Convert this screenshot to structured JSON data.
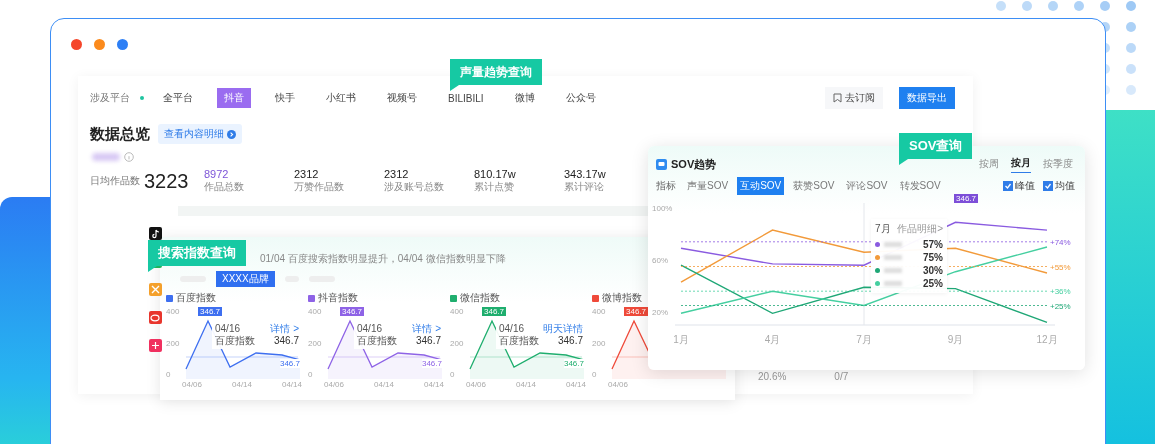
{
  "overview": {
    "platform_filter": {
      "label": "涉及平台",
      "options": [
        {
          "label": "全平台",
          "selected": false
        },
        {
          "label": "抖音",
          "selected": true
        },
        {
          "label": "快手",
          "selected": false
        },
        {
          "label": "小红书",
          "selected": false
        },
        {
          "label": "视频号",
          "selected": false
        },
        {
          "label": "BILIBILI",
          "selected": false
        },
        {
          "label": "微博",
          "selected": false
        },
        {
          "label": "公众号",
          "selected": false
        }
      ]
    },
    "subscribe": "去订阅",
    "export": "数据导出",
    "title": "数据总览",
    "detail_link": "查看内容明细",
    "daily": {
      "label": "日均作品数",
      "value": "3223"
    },
    "stats": [
      {
        "value": "8972",
        "label": "作品总数",
        "highlight": true
      },
      {
        "value": "2312",
        "label": "万赞作品数",
        "highlight": false
      },
      {
        "value": "2312",
        "label": "涉及账号总数",
        "highlight": false
      },
      {
        "value": "810.17w",
        "label": "累计点赞",
        "highlight": false
      },
      {
        "value": "343.17w",
        "label": "累计评论",
        "highlight": false
      }
    ],
    "bottom_row": [
      "20.6%",
      "0/7"
    ]
  },
  "volume_callout": "声量趋势查询",
  "search_panel": {
    "callout": "搜索指数查询",
    "summary": "01/04 百度搜索指数明显提升，04/04 微信指数明显下降",
    "brand_tab": "XXXX品牌",
    "charts": [
      {
        "title": "百度指数",
        "color": "#3e6ff0",
        "peak": "346.7",
        "end": "346.7",
        "y_labels": [
          "400",
          "200",
          "0"
        ],
        "x_labels": [
          "04/06",
          "04/14",
          "04/14"
        ],
        "tooltip": {
          "date": "04/16",
          "link": "详情 >",
          "series": "百度指数",
          "value": "346.7"
        }
      },
      {
        "title": "抖音指数",
        "color": "#8e63e6",
        "peak": "346.7",
        "end": "346.7",
        "y_labels": [
          "400",
          "200",
          "0"
        ],
        "x_labels": [
          "04/06",
          "04/14",
          "04/14"
        ],
        "tooltip": {
          "date": "04/16",
          "link": "详情 >",
          "series": "百度指数",
          "value": "346.7"
        }
      },
      {
        "title": "微信指数",
        "color": "#1fae6e",
        "peak": "346.7",
        "end": "346.7",
        "y_labels": [
          "400",
          "200",
          "0"
        ],
        "x_labels": [
          "04/06",
          "04/14",
          "04/14"
        ],
        "tooltip": {
          "date": "04/16",
          "link": "明天详情",
          "series": "百度指数",
          "value": "346.7"
        }
      },
      {
        "title": "微博指数",
        "color": "#ef4a3a",
        "peak": "346.7",
        "y_labels": [
          "400",
          "200",
          "0"
        ],
        "x_labels": [
          "04/06"
        ]
      }
    ]
  },
  "sov_panel": {
    "callout": "SOV查询",
    "title": "SOV趋势",
    "periods": [
      {
        "label": "按周",
        "selected": false
      },
      {
        "label": "按月",
        "selected": true
      },
      {
        "label": "按季度",
        "selected": false
      }
    ],
    "metric_label": "指标",
    "metrics": [
      {
        "label": "声量SOV",
        "selected": false
      },
      {
        "label": "互动SOV",
        "selected": true
      },
      {
        "label": "获赞SOV",
        "selected": false
      },
      {
        "label": "评论SOV",
        "selected": false
      },
      {
        "label": "转发SOV",
        "selected": false
      }
    ],
    "toggles": [
      {
        "label": "峰值",
        "checked": true
      },
      {
        "label": "均值",
        "checked": true
      }
    ],
    "chart_data": {
      "type": "line",
      "categories": [
        "1月",
        "4月",
        "7月",
        "9月",
        "12月"
      ],
      "ylim": [
        10,
        100
      ],
      "yticks": [
        {
          "value": 20,
          "label": "20%"
        },
        {
          "value": 60,
          "label": "60%"
        },
        {
          "value": 100,
          "label": "100%"
        }
      ],
      "series": [
        {
          "color": "#8a5be0",
          "values": [
            69,
            57,
            56,
            89,
            83
          ]
        },
        {
          "color": "#f29a3a",
          "values": [
            43,
            83,
            66,
            69,
            50
          ]
        },
        {
          "color": "#1fa776",
          "values": [
            56,
            19,
            39,
            38,
            12
          ]
        },
        {
          "color": "#45cfa0",
          "values": [
            19,
            36,
            25,
            51,
            70
          ]
        },
        {
          "color": "#8a5be0",
          "line_style": "dashed",
          "values": [
            74,
            74,
            74,
            74,
            74
          ]
        },
        {
          "color": "#f29a3a",
          "line_style": "dashed",
          "values": [
            55,
            55,
            55,
            55,
            55
          ]
        },
        {
          "color": "#45cfa0",
          "line_style": "dashed",
          "values": [
            36,
            36,
            36,
            36,
            36
          ]
        },
        {
          "color": "#1fa776",
          "line_style": "dashed",
          "values": [
            25,
            25,
            25,
            25,
            25
          ]
        }
      ]
    },
    "average_labels": [
      "+74%",
      "+55%",
      "+36%",
      "+25%"
    ],
    "peak_label": "346.7",
    "tooltip": {
      "title": "7月",
      "link": "作品明细>",
      "rows": [
        {
          "color": "#8a5be0",
          "value": "57%"
        },
        {
          "color": "#f29a3a",
          "value": "75%"
        },
        {
          "color": "#1fa776",
          "value": "30%"
        },
        {
          "color": "#45cfa0",
          "value": "25%"
        }
      ]
    }
  }
}
